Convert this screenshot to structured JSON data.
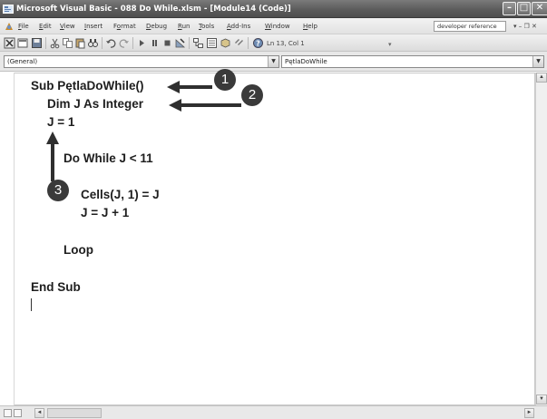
{
  "window": {
    "title": "Microsoft Visual Basic - 088 Do While.xlsm - [Module14 (Code)]"
  },
  "menu": {
    "items": [
      {
        "pre": "",
        "key": "F",
        "post": "ile"
      },
      {
        "pre": "",
        "key": "E",
        "post": "dit"
      },
      {
        "pre": "",
        "key": "V",
        "post": "iew"
      },
      {
        "pre": "",
        "key": "I",
        "post": "nsert"
      },
      {
        "pre": "F",
        "key": "o",
        "post": "rmat"
      },
      {
        "pre": "",
        "key": "D",
        "post": "ebug"
      },
      {
        "pre": "",
        "key": "R",
        "post": "un"
      },
      {
        "pre": "",
        "key": "T",
        "post": "ools"
      },
      {
        "pre": "",
        "key": "A",
        "post": "dd-Ins"
      },
      {
        "pre": "",
        "key": "W",
        "post": "indow"
      },
      {
        "pre": "",
        "key": "H",
        "post": "elp"
      }
    ],
    "help_search": "developer reference",
    "window_controls": "▾ – ❐ ✕"
  },
  "toolbar": {
    "cursor_position": "Ln 13, Col 1",
    "icons": [
      "excel-icon",
      "insert-module-icon",
      "save-icon",
      "cut-icon",
      "copy-icon",
      "paste-icon",
      "find-icon",
      "undo-icon",
      "redo-icon",
      "run-icon",
      "break-icon",
      "reset-icon",
      "design-mode-icon",
      "project-explorer-icon",
      "properties-icon",
      "object-browser-icon",
      "toolbox-icon",
      "help-icon"
    ]
  },
  "combos": {
    "object": "(General)",
    "procedure": "PętlaDoWhile"
  },
  "code": {
    "lines": [
      "Sub PętlaDoWhile()",
      "Dim J As Integer",
      "J = 1",
      "Do While J < 11",
      "Cells(J, 1) = J",
      "J = J + 1",
      "Loop",
      "End Sub"
    ]
  },
  "callouts": {
    "one": "1",
    "two": "2",
    "three": "3"
  },
  "colors": {
    "callout": "#3a3a3a",
    "titlebar": "#5c5c5c",
    "code_text": "#1e1e1e"
  }
}
